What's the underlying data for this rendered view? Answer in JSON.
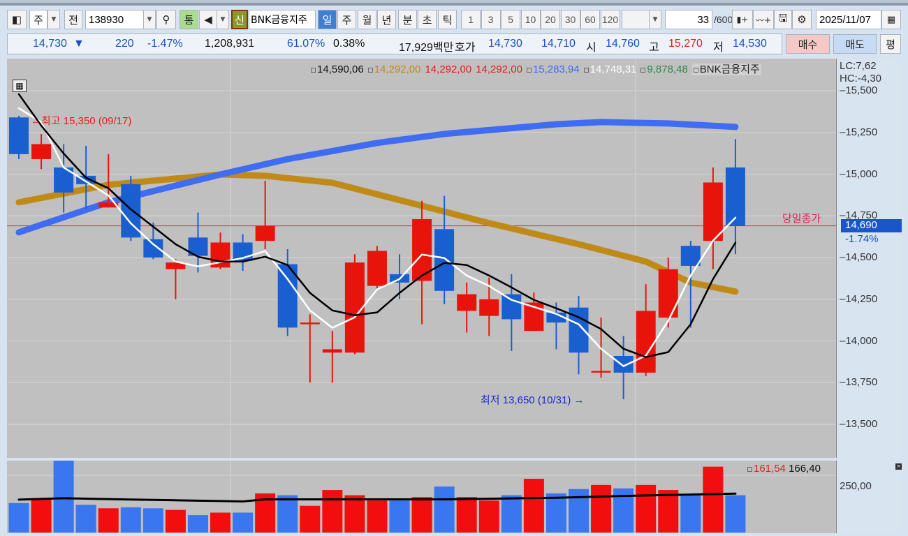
{
  "toolbar": {
    "period_mode": "주",
    "prev_label": "전",
    "code": "138930",
    "trade_label": "통",
    "new_label": "신",
    "stock_name": "BNK금융지주",
    "timeframes": [
      "일",
      "주",
      "월",
      "년",
      "분",
      "초",
      "틱"
    ],
    "selected_timeframe": "일",
    "intervals": [
      "1",
      "3",
      "5",
      "10",
      "20",
      "30",
      "60",
      "120"
    ],
    "count": "33",
    "count_max": "/600",
    "date": "2025/11/07"
  },
  "quote": {
    "price": "14,730",
    "direction": "▼",
    "change": "220",
    "change_pct": "-1.47%",
    "volume": "1,208,931",
    "vol_ratio": "61.07%",
    "turnover": "0.38%",
    "amount": "17,929백만",
    "ask_label": "호가",
    "ask": "14,730",
    "bid": "14,710",
    "open_label": "시",
    "open": "14,760",
    "high_label": "고",
    "high": "15,270",
    "low_label": "저",
    "low": "14,530",
    "buy_label": "매수",
    "sell_label": "매도",
    "eval_label": "평"
  },
  "legend": {
    "v1": "14,590,06",
    "v2": "14,292,00",
    "v3": "14,292,00",
    "v4": "14,292,00",
    "v5": "15,283,94",
    "v6": "14,748,31",
    "v7": "9,878,48",
    "name": "BNK금융지주",
    "lc": "LC:7,62",
    "hc": "HC:-4,30"
  },
  "annotations": {
    "high": "←최고 15,350 (09/17)",
    "low": "최저 13,650 (10/31) →",
    "close_line": "당일종가",
    "close_value": "14,690",
    "close_pct": "-1.74%"
  },
  "colors": {
    "up": "#e8140c",
    "down": "#1a5fd0",
    "ma_white": "#ffffff",
    "ma_black": "#000000",
    "ma_gold": "#c08a18",
    "ma_blue": "#3f6cf0"
  },
  "chart_data": {
    "type": "candlestick",
    "ylim": [
      13300,
      15600
    ],
    "y_ticks": [
      "15,500",
      "15,250",
      "15,000",
      "14,750",
      "14,500",
      "14,250",
      "14,000",
      "13,750",
      "13,500"
    ],
    "y_tick_values": [
      15500,
      15250,
      15000,
      14750,
      14500,
      14250,
      14000,
      13750,
      13500
    ],
    "close_line": 14690,
    "ohlc": [
      [
        15340,
        15350,
        15090,
        15120
      ],
      [
        15090,
        15240,
        15030,
        15180
      ],
      [
        15040,
        15180,
        14770,
        14890
      ],
      [
        14990,
        15170,
        14790,
        14940
      ],
      [
        14800,
        15120,
        14800,
        14830
      ],
      [
        14940,
        14990,
        14600,
        14620
      ],
      [
        14610,
        14710,
        14490,
        14500
      ],
      [
        14430,
        14490,
        14250,
        14470
      ],
      [
        14620,
        14770,
        14410,
        14510
      ],
      [
        14440,
        14650,
        14430,
        14590
      ],
      [
        14590,
        14640,
        14420,
        14480
      ],
      [
        14600,
        14960,
        14550,
        14690
      ],
      [
        14460,
        14550,
        14030,
        14080
      ],
      [
        14100,
        14160,
        13750,
        14110
      ],
      [
        13930,
        14060,
        13750,
        13950
      ],
      [
        13930,
        14520,
        13920,
        14470
      ],
      [
        14330,
        14570,
        14310,
        14540
      ],
      [
        14400,
        14520,
        14250,
        14350
      ],
      [
        14360,
        14840,
        14100,
        14730
      ],
      [
        14670,
        14870,
        14220,
        14300
      ],
      [
        14180,
        14350,
        14050,
        14280
      ],
      [
        14150,
        14380,
        14030,
        14250
      ],
      [
        14280,
        14400,
        13940,
        14130
      ],
      [
        14060,
        14290,
        14060,
        14230
      ],
      [
        14170,
        14230,
        13950,
        14110
      ],
      [
        14200,
        14270,
        13800,
        13930
      ],
      [
        13810,
        14140,
        13780,
        13820
      ],
      [
        13910,
        14030,
        13650,
        13810
      ],
      [
        13810,
        14340,
        13790,
        14180
      ],
      [
        14140,
        14500,
        14080,
        14430
      ],
      [
        14570,
        14600,
        14080,
        14450
      ],
      [
        14600,
        15040,
        14430,
        14950
      ],
      [
        15040,
        15210,
        14520,
        14690
      ]
    ],
    "ma": [
      {
        "name": "white",
        "values": [
          15395,
          15312,
          15040,
          14956,
          14872,
          14705,
          14580,
          14476,
          14447,
          14472,
          14497,
          14539,
          14371,
          14183,
          14079,
          14142,
          14309,
          14371,
          14518,
          14497,
          14392,
          14330,
          14246,
          14204,
          14162,
          14100,
          13953,
          13849,
          13912,
          14121,
          14392,
          14601,
          14739
        ]
      },
      {
        "name": "black",
        "values": [
          15479,
          15291,
          15124,
          14978,
          14915,
          14789,
          14685,
          14580,
          14505,
          14476,
          14476,
          14505,
          14455,
          14288,
          14183,
          14154,
          14171,
          14288,
          14392,
          14468,
          14455,
          14392,
          14321,
          14246,
          14196,
          14142,
          14071,
          13953,
          13903,
          13933,
          14100,
          14371,
          14589
        ]
      },
      {
        "name": "gold",
        "points": [
          [
            1,
            14831
          ],
          [
            5,
            14936
          ],
          [
            10,
            14998
          ],
          [
            12,
            14990
          ],
          [
            15,
            14948
          ],
          [
            19,
            14810
          ],
          [
            22,
            14706
          ],
          [
            26,
            14580
          ],
          [
            29,
            14476
          ],
          [
            31,
            14350
          ],
          [
            33,
            14296
          ]
        ]
      },
      {
        "name": "blue",
        "points": [
          [
            1,
            14651
          ],
          [
            5,
            14831
          ],
          [
            10,
            14998
          ],
          [
            13,
            15090
          ],
          [
            17,
            15187
          ],
          [
            20,
            15241
          ],
          [
            25,
            15299
          ],
          [
            27,
            15312
          ],
          [
            30,
            15304
          ],
          [
            33,
            15283
          ]
        ]
      }
    ],
    "volume": {
      "values": [
        129,
        144,
        322,
        121,
        106,
        110,
        106,
        99,
        76,
        87,
        87,
        171,
        163,
        117,
        186,
        163,
        140,
        140,
        155,
        201,
        155,
        140,
        163,
        235,
        171,
        190,
        208,
        193,
        208,
        186,
        163,
        288,
        163
      ],
      "up": [
        0,
        1,
        0,
        0,
        1,
        0,
        0,
        1,
        0,
        1,
        0,
        1,
        0,
        1,
        1,
        1,
        1,
        0,
        1,
        0,
        1,
        1,
        0,
        1,
        0,
        0,
        1,
        0,
        1,
        1,
        0,
        1,
        0
      ],
      "ma_points": [
        [
          1,
          144
        ],
        [
          3,
          150
        ],
        [
          5,
          146
        ],
        [
          8,
          141
        ],
        [
          11,
          136
        ],
        [
          12,
          145
        ],
        [
          20,
          145
        ],
        [
          25,
          152
        ],
        [
          28,
          160
        ],
        [
          33,
          170
        ]
      ],
      "ylim": [
        0,
        290
      ],
      "tick": "250,00",
      "legend_v1": "161,54",
      "legend_v2": "166,40"
    }
  }
}
